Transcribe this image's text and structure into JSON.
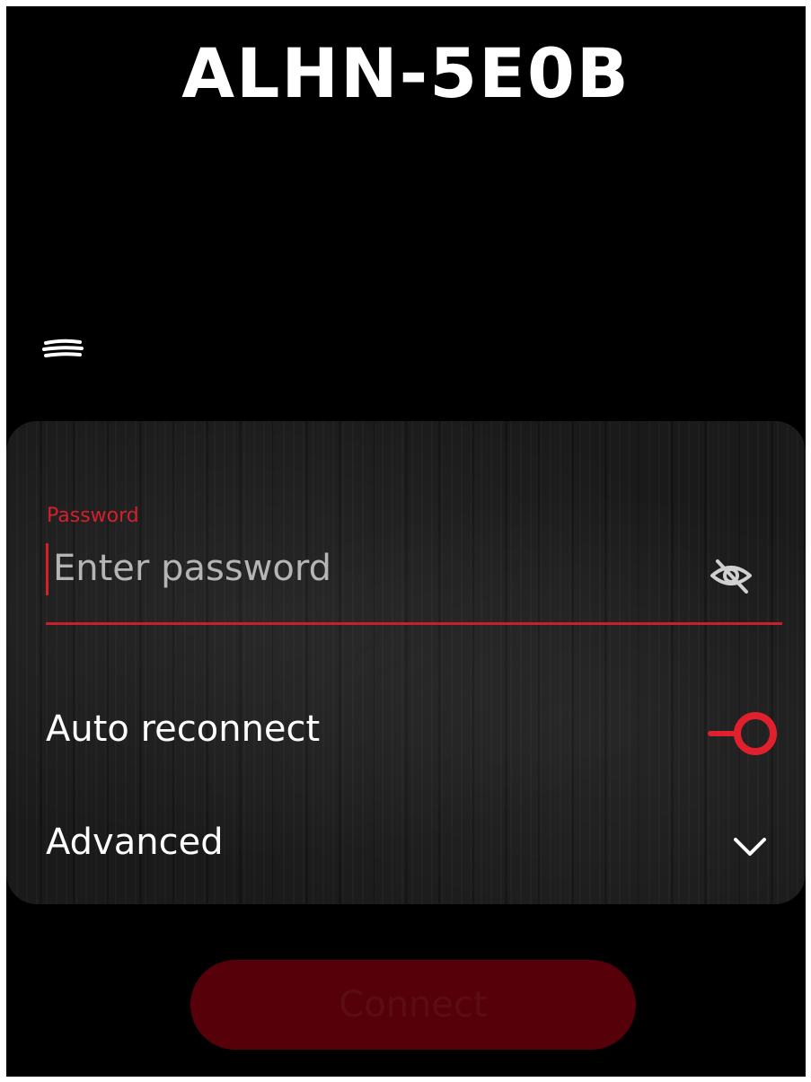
{
  "header": {
    "network_name": "ALHN-5E0B"
  },
  "password": {
    "label": "Password",
    "placeholder": "Enter password",
    "value": ""
  },
  "options": {
    "auto_reconnect_label": "Auto reconnect",
    "auto_reconnect_on": true,
    "advanced_label": "Advanced"
  },
  "actions": {
    "connect_label": "Connect"
  },
  "icons": {
    "menu": "menu-icon",
    "visibility": "eye-off-icon",
    "toggle": "toggle-switch",
    "expand": "chevron-down-icon"
  },
  "colors": {
    "background": "#000000",
    "accent": "#d4202a",
    "connect_button": "#56000a",
    "text": "#ffffff"
  }
}
